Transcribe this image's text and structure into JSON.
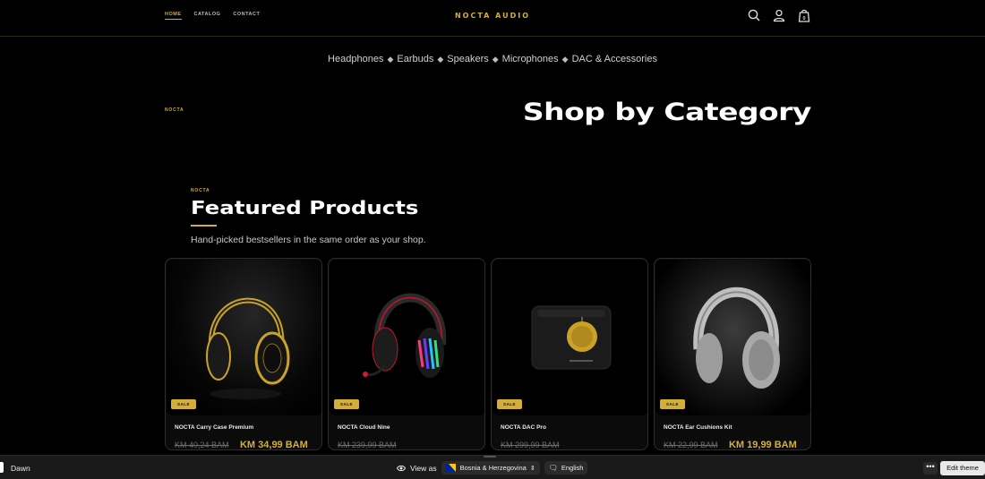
{
  "header": {
    "nav": [
      "HOME",
      "CATALOG",
      "CONTACT"
    ],
    "logo": "NOCTA AUDIO",
    "icons": [
      "search-icon",
      "account-icon",
      "cart-icon"
    ],
    "cart_count": "0"
  },
  "category_menu": {
    "items": [
      "Headphones",
      "Earbuds",
      "Speakers",
      "Microphones",
      "DAC & Accessories"
    ],
    "separator": "◆"
  },
  "shop_section": {
    "eyebrow": "NOCTA",
    "title": "Shop by Category"
  },
  "featured": {
    "eyebrow": "NOCTA",
    "title": "Featured Products",
    "subtitle": "Hand-picked bestsellers in the same order as your shop.",
    "products": [
      {
        "badge": "SALE",
        "name": "NOCTA Carry Case Premium",
        "old_price": "KM 40,24 BAM",
        "price": "KM 34,99 BAM"
      },
      {
        "badge": "SALE",
        "name": "NOCTA Cloud Nine",
        "old_price": "KM 239,99 BAM",
        "price": ""
      },
      {
        "badge": "SALE",
        "name": "NOCTA DAC Pro",
        "old_price": "KM 299,99 BAM",
        "price": ""
      },
      {
        "badge": "SALE",
        "name": "NOCTA Ear Cushions Kit",
        "old_price": "KM 22,99 BAM",
        "price": "KM 19,99 BAM"
      }
    ]
  },
  "editor_bar": {
    "theme_name": "Dawn",
    "view_as_label": "View as",
    "country": "Bosnia & Herzegovina",
    "language": "English",
    "more_label": "•••",
    "edit_button": "Edit theme"
  },
  "colors": {
    "accent": "#d4af37",
    "background": "#000000",
    "card": "#0b0b0b"
  }
}
